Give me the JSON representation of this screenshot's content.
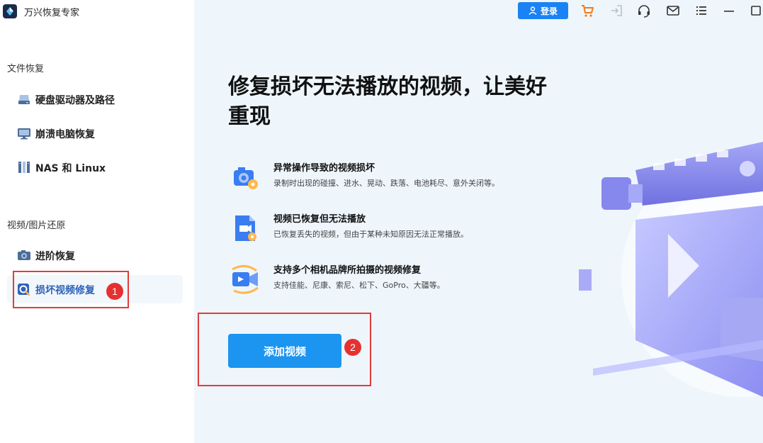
{
  "app": {
    "name": "万兴恢复专家"
  },
  "sidebar": {
    "section_file": "文件恢复",
    "file_items": [
      {
        "label": "硬盘驱动器及路径",
        "icon": "hard-drive-icon"
      },
      {
        "label": "崩溃电脑恢复",
        "icon": "monitor-icon"
      },
      {
        "label": "NAS 和 Linux",
        "icon": "server-icon"
      }
    ],
    "section_media": "视频/图片还原",
    "media_items": [
      {
        "label": "进阶恢复",
        "icon": "camera-icon"
      },
      {
        "label": "损坏视频修复",
        "icon": "video-repair-icon",
        "active": true
      }
    ]
  },
  "annotations": {
    "badge1": "1",
    "badge2": "2"
  },
  "topbar": {
    "login_label": "登录",
    "icons": [
      "cart-icon",
      "sign-in-icon",
      "headset-icon",
      "mail-icon",
      "menu-icon",
      "minimize-icon",
      "maximize-icon"
    ]
  },
  "main": {
    "title": "修复损坏无法播放的视频，让美好重现",
    "features": [
      {
        "title": "异常操作导致的视频损坏",
        "desc": "录制时出现的碰撞、进水、晃动、跌落、电池耗尽、意外关闭等。",
        "icon": "camera-gear-icon"
      },
      {
        "title": "视频已恢复但无法播放",
        "desc": "已恢复丢失的视频，但由于某种未知原因无法正常播放。",
        "icon": "video-file-icon"
      },
      {
        "title": "支持多个相机品牌所拍摄的视频修复",
        "desc": "支持佳能、尼康、索尼、松下、GoPro、大疆等。",
        "icon": "video-camera-icon"
      }
    ],
    "add_button": "添加视频"
  },
  "colors": {
    "accent": "#1b95f0",
    "login": "#1b82f5",
    "active_text": "#2e62b8",
    "annotation": "#e23b3b"
  }
}
